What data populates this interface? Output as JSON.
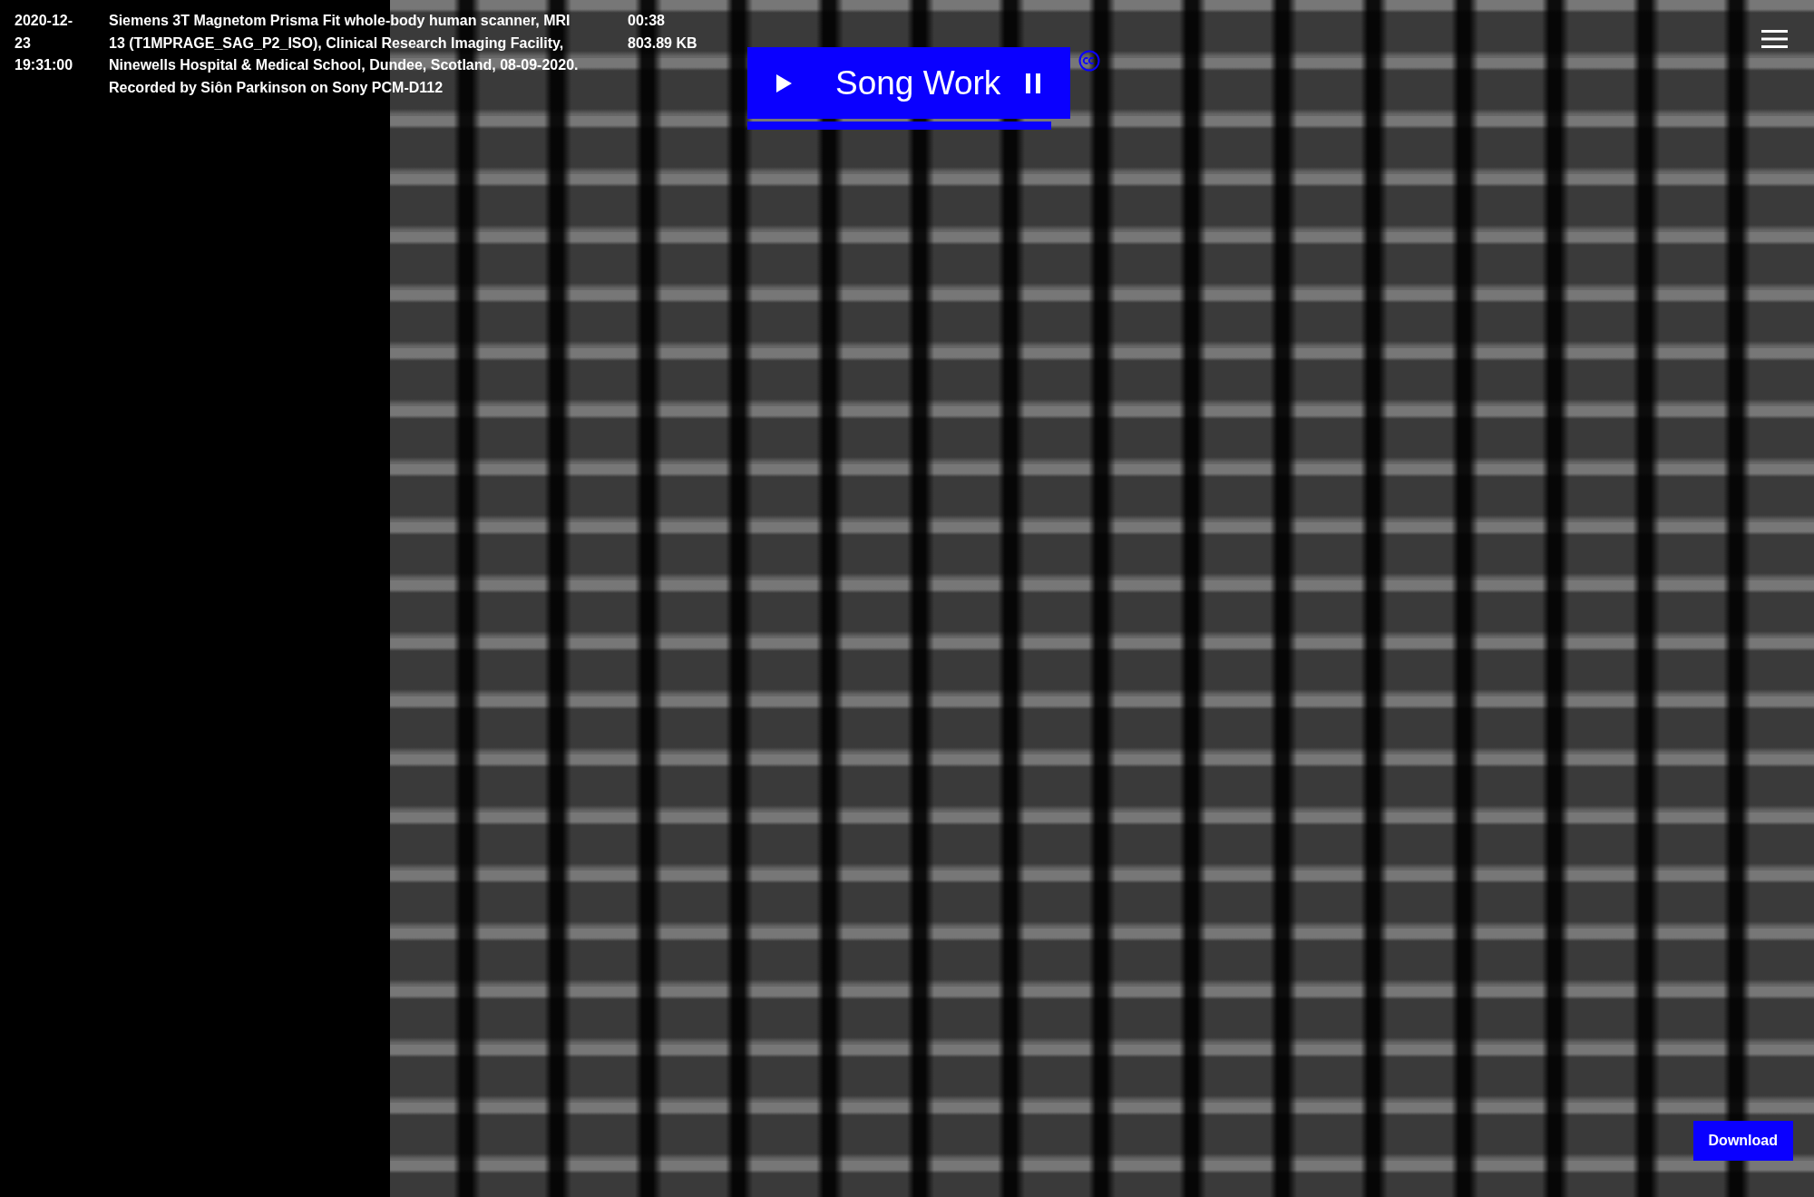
{
  "recording": {
    "date": "2020-12-23 19:31:00",
    "description": "Siemens 3T Magnetom Prisma Fit whole-body human scanner, MRI 13 (T1MPRAGE_SAG_P2_ISO), Clinical Research Imaging Facility, Ninewells Hospital & Medical School, Dundee, Scotland, 08-09-2020. Recorded by Siôn Parkinson on Sony PCM-D112",
    "duration": "00:38",
    "size": "803.89 KB"
  },
  "player": {
    "title": "Song Work",
    "level": 0.94
  },
  "download": {
    "label": "Download"
  }
}
